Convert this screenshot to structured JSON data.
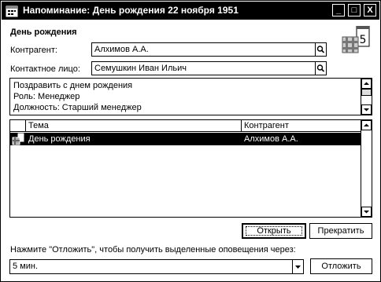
{
  "window": {
    "title": "Напоминание: День рождения 22 ноября 1951",
    "minimize_glyph": "_",
    "maximize_glyph": "□",
    "close_glyph": "X"
  },
  "header": {
    "section_title": "День рождения",
    "icon": "calendar-birthday-icon",
    "calendar_day": "5"
  },
  "fields": {
    "counterparty_label": "Контрагент:",
    "counterparty_value": "Алхимов А.А.",
    "contact_label": "Контактное лицо:",
    "contact_value": "Семушкин Иван Ильич"
  },
  "memo": {
    "lines": [
      "Поздравить с днем рождения",
      "Роль: Менеджер",
      "Должность: Старший менеджер"
    ]
  },
  "table": {
    "columns": [
      "Тема",
      "Контрагент"
    ],
    "rows": [
      {
        "icon": "reminder-row-icon",
        "topic": "День рождения",
        "counterparty": "Алхимов А.А."
      }
    ]
  },
  "buttons": {
    "open": "Открыть",
    "stop": "Прекратить",
    "snooze": "Отложить"
  },
  "snooze": {
    "prompt": "Нажмите \"Отложить\", чтобы получить выделенные оповещения через:",
    "selected": "5 мин."
  }
}
